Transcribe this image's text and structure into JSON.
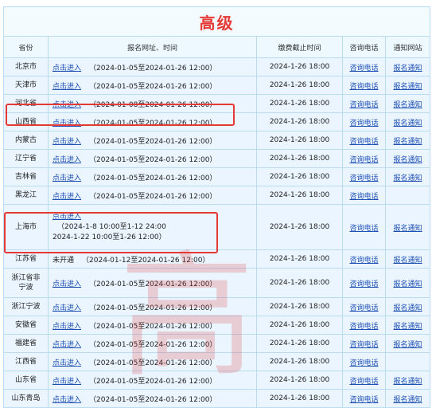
{
  "title": "高级",
  "headers": {
    "province": "省份",
    "reg": "报名网址、时间",
    "deadline": "缴费截止时间",
    "phone": "咨询电话",
    "notice": "通知网站"
  },
  "link_text": "点击进入",
  "phone_text": "咨询电话",
  "notice_text": "报名通知",
  "rows": [
    {
      "province": "北京市",
      "dates": "（2024-01-05至2024-01-26 12:00）",
      "deadline": "2024-1-26 18:00",
      "notice": true
    },
    {
      "province": "天津市",
      "dates": "（2024-01-05至2024-01-26 12:00）",
      "deadline": "2024-1-26 18:00",
      "notice": true
    },
    {
      "province": "河北省",
      "dates": "（2024-01-08至2024-01-26 12:00）",
      "deadline": "2024-1-26 18:00",
      "notice": true
    },
    {
      "province": "山西省",
      "dates": "（2024-01-05至2024-01-26 12:00）",
      "deadline": "2024-1-26 18:00",
      "notice": true
    },
    {
      "province": "内蒙古",
      "dates": "（2024-01-05至2024-01-26 12:00）",
      "deadline": "2024-1-26 18:00",
      "notice": true
    },
    {
      "province": "辽宁省",
      "dates": "（2024-01-05至2024-01-26 12:00）",
      "deadline": "2024-1-26 18:00",
      "notice": true
    },
    {
      "province": "吉林省",
      "dates": "（2024-01-05至2024-01-26 12:00）",
      "deadline": "2024-1-26 18:00",
      "notice": true
    },
    {
      "province": "黑龙江",
      "dates": "（2024-01-05至2024-01-26 12:00）",
      "deadline": "2024-1-26 18:00",
      "notice": false
    },
    {
      "province": "上海市",
      "lines": [
        "（2024-1-8 10:00至1-12 24:00",
        "2024-1-22 10:00至1-26 12:00）"
      ],
      "deadline": "2024-1-26 18:00",
      "notice": true
    },
    {
      "province": "江苏省",
      "nolink": "未开通",
      "dates": "（2024-01-12至2024-01-26 12:00）",
      "deadline": "2024-1-26 18:00",
      "notice": true
    },
    {
      "province": "浙江省非宁波",
      "dates": "（2024-01-05至2024-01-26 12:00）",
      "deadline": "2024-1-26 18:00",
      "notice": true
    },
    {
      "province": "浙江宁波",
      "dates": "（2024-01-05至2024-01-26 12:00）",
      "deadline": "2024-1-26 18:00",
      "notice": true
    },
    {
      "province": "安徽省",
      "dates": "（2024-01-05至2024-01-26 12:00）",
      "deadline": "2024-1-26 18:00",
      "notice": true
    },
    {
      "province": "福建省",
      "dates": "（2024-01-05至2024-01-26 12:00）",
      "deadline": "2024-1-26 18:00",
      "notice": true
    },
    {
      "province": "江西省",
      "dates": "（2024-01-05至2024-01-26 12:00）",
      "deadline": "2024-1-26 18:00",
      "notice": false
    },
    {
      "province": "山东省",
      "dates": "（2024-01-05至2024-01-26 12:00）",
      "deadline": "2024-1-26 18:00",
      "notice": true
    },
    {
      "province": "山东青岛",
      "dates": "（2024-01-05至2024-01-26 12:00）",
      "deadline": "2024-1-26 18:00",
      "notice": true
    }
  ],
  "watermark": "高",
  "colors": {
    "title_red": "#e53935",
    "link_blue": "#1e4fb3",
    "table_bg": "#eaf5ff",
    "border": "#b9dcf2"
  }
}
